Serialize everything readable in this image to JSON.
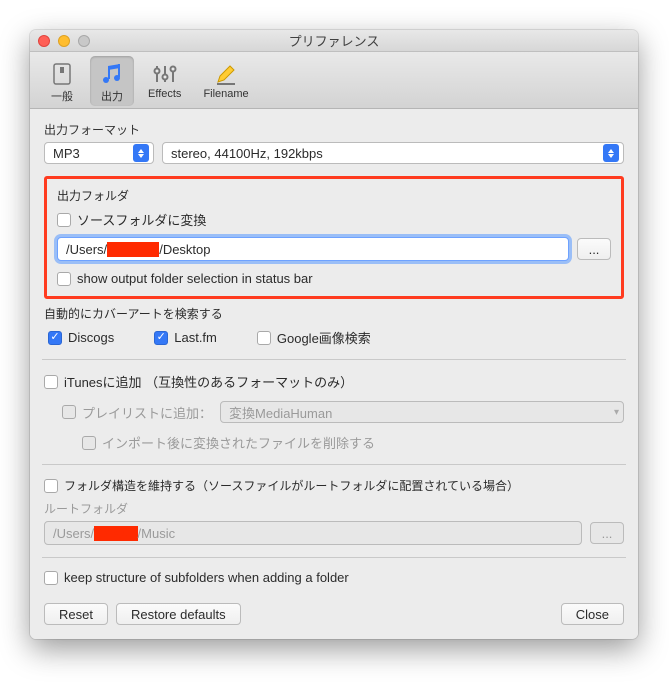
{
  "window": {
    "title": "プリファレンス"
  },
  "toolbar": {
    "general": "一般",
    "output": "出力",
    "effects": "Effects",
    "filename": "Filename"
  },
  "format": {
    "section": "出力フォーマット",
    "codec": "MP3",
    "params": "stereo, 44100Hz, 192kbps"
  },
  "folder": {
    "section": "出力フォルダ",
    "convertToSource": "ソースフォルダに変換",
    "path1": "/Users/",
    "redacted": "XXXXXX",
    "path2": "/Desktop",
    "browse": "...",
    "showStatus": "show output folder selection in status bar"
  },
  "coverart": {
    "section": "自動的にカバーアートを検索する",
    "discogs": "Discogs",
    "lastfm": "Last.fm",
    "google": "Google画像検索"
  },
  "itunes": {
    "add": "iTunesに追加 （互換性のあるフォーマットのみ）",
    "playlist": "プレイリストに追加：",
    "playlistName": "変換MediaHuman",
    "deleteAfter": "インポート後に変換されたファイルを削除する"
  },
  "structure": {
    "keep": "フォルダ構造を維持する（ソースファイルがルートフォルダに配置されている場合）",
    "rootLabel": "ルートフォルダ",
    "rootPath1": "/Users/",
    "rootRedacted": "XXXXX",
    "rootPath2": "/Music",
    "browse": "...",
    "keepSub": "keep structure of subfolders when adding a folder"
  },
  "buttons": {
    "reset": "Reset",
    "restore": "Restore defaults",
    "close": "Close"
  }
}
